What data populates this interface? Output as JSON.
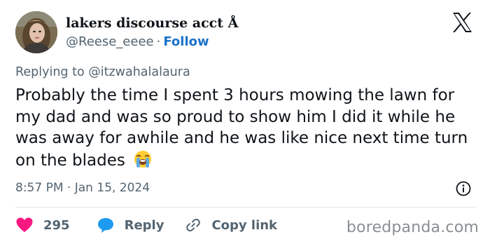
{
  "author": {
    "display_name": "lakers discourse acct Å",
    "handle": "@Reese_eeee",
    "separator": "·",
    "follow_label": "Follow"
  },
  "reply_context": {
    "prefix": "Replying to",
    "mention": "@itzwahalalaura"
  },
  "tweet": {
    "text": "Probably the time I spent 3 hours mowing the lawn for my dad and was so proud to show him I did it while he was away for awhile and he was like nice next time turn on the blades",
    "emoji": "loudly-crying-face",
    "timestamp": "8:57 PM · Jan 15, 2024"
  },
  "actions": {
    "like_count": "295",
    "reply_label": "Reply",
    "copy_link_label": "Copy link"
  },
  "watermark": "boredpanda.com",
  "colors": {
    "follow": "#1d72c9",
    "like": "#f91880",
    "reply": "#1d9bf0",
    "muted": "#536471",
    "text": "#0f1419"
  }
}
